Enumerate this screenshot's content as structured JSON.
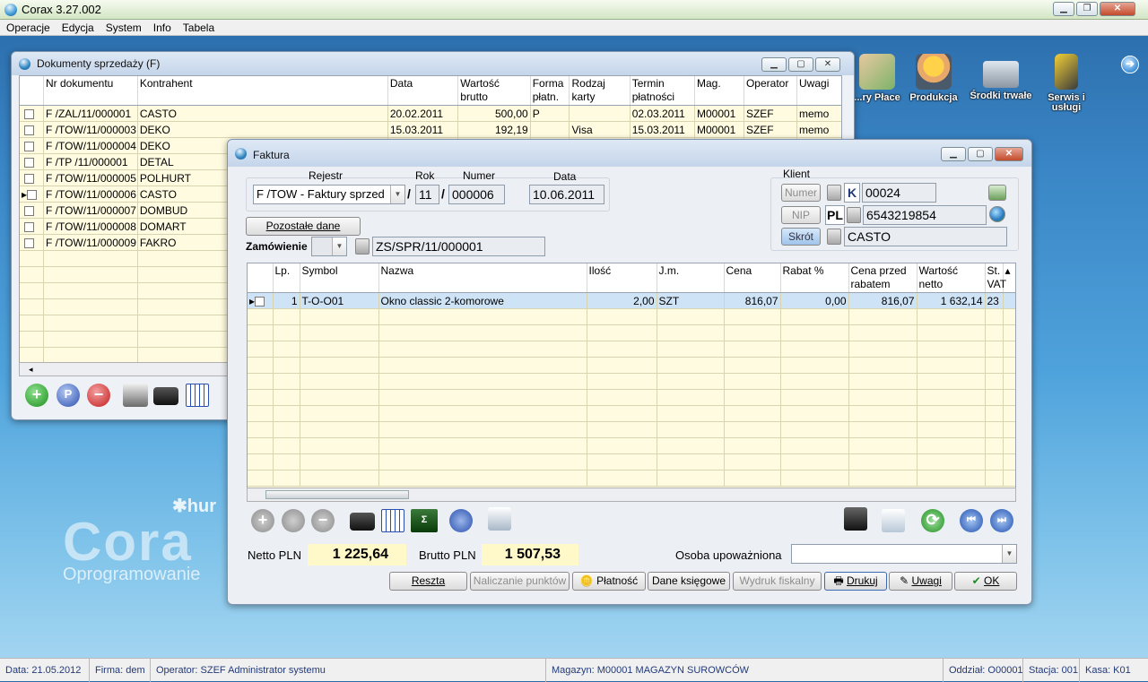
{
  "app": {
    "title": "Corax 3.27.002"
  },
  "menu": [
    "Operacje",
    "Edycja",
    "System",
    "Info",
    "Tabela"
  ],
  "desktop_icons": [
    {
      "label": "...ry Płace",
      "icon": "money-hand-icon"
    },
    {
      "label": "Produkcja",
      "icon": "worker-icon"
    },
    {
      "label": "Środki trwałe",
      "icon": "truck-icon"
    },
    {
      "label": "Serwis i usługi",
      "icon": "drill-icon"
    }
  ],
  "brand": {
    "small": "hur",
    "big": "Cora",
    "tag": "Oprogramowanie"
  },
  "list_window": {
    "title": "Dokumenty sprzedaży (F)",
    "columns": [
      "Nr dokumentu",
      "Kontrahent",
      "Data",
      "Wartość brutto",
      "Forma płatn.",
      "Rodzaj karty",
      "Termin płatności",
      "Mag.",
      "Operator",
      "Uwagi"
    ],
    "rows": [
      [
        "F /ZAL/11/000001",
        "CASTO",
        "20.02.2011",
        "500,00",
        "P",
        "",
        "02.03.2011",
        "M00001",
        "SZEF",
        "memo"
      ],
      [
        "F /TOW/11/000003",
        "DEKO",
        "15.03.2011",
        "192,19",
        "",
        "Visa",
        "15.03.2011",
        "M00001",
        "SZEF",
        "memo"
      ],
      [
        "F /TOW/11/000004",
        "DEKO",
        "",
        "",
        "",
        "",
        "",
        "",
        "",
        ""
      ],
      [
        "F /TP /11/000001",
        "DETAL",
        "",
        "",
        "",
        "",
        "",
        "",
        "",
        ""
      ],
      [
        "F /TOW/11/000005",
        "POLHURT",
        "",
        "",
        "",
        "",
        "",
        "",
        "",
        ""
      ],
      [
        "F /TOW/11/000006",
        "CASTO",
        "",
        "",
        "",
        "",
        "",
        "",
        "",
        ""
      ],
      [
        "F /TOW/11/000007",
        "DOMBUD",
        "",
        "",
        "",
        "",
        "",
        "",
        "",
        ""
      ],
      [
        "F /TOW/11/000008",
        "DOMART",
        "",
        "",
        "",
        "",
        "",
        "",
        "",
        ""
      ],
      [
        "F /TOW/11/000009",
        "FAKRO",
        "",
        "",
        "",
        "",
        "",
        "",
        "",
        ""
      ]
    ]
  },
  "invoice": {
    "title": "Faktura",
    "rejestr_label": "Rejestr",
    "rok_label": "Rok",
    "numer_label": "Numer",
    "data_label": "Data",
    "rejestr": "F /TOW - Faktury sprzed",
    "rok": "11",
    "numer": "000006",
    "data": "10.06.2011",
    "slash": "/",
    "pozostale": "Pozostałe dane",
    "zamowienie_label": "Zamówienie",
    "zamowienie": "ZS/SPR/11/000001",
    "klient_label": "Klient",
    "numer_btn": "Numer",
    "nip_btn": "NIP",
    "skrot_btn": "Skrót",
    "k_prefix": "K",
    "k_value": "00024",
    "pl_prefix": "PL",
    "nip_value": "6543219854",
    "skrot_value": "CASTO",
    "columns": [
      "Lp.",
      "Symbol",
      "Nazwa",
      "Ilość",
      "J.m.",
      "Cena",
      "Rabat %",
      "Cena przed rabatem",
      "Wartość netto",
      "St. VAT"
    ],
    "items": [
      {
        "lp": "1",
        "symbol": "T-O-O01",
        "nazwa": "Okno classic 2-komorowe",
        "ilosc": "2,00",
        "jm": "SZT",
        "cena": "816,07",
        "rabat": "0,00",
        "cena_przed": "816,07",
        "wartosc": "1 632,14",
        "vat": "23"
      }
    ],
    "netto_label": "Netto PLN",
    "netto": "1 225,64",
    "brutto_label": "Brutto PLN",
    "brutto": "1 507,53",
    "osoba_label": "Osoba upoważniona",
    "buttons": {
      "reszta": "Reszta",
      "punkty": "Naliczanie punktów",
      "platnosc": "Płatność",
      "ksiegowe": "Dane księgowe",
      "fiskalny": "Wydruk fiskalny",
      "drukuj": "Drukuj",
      "uwagi": "Uwagi",
      "ok": "OK"
    }
  },
  "status": {
    "data": "Data: 21.05.2012",
    "firma": "Firma: dem",
    "operator": "Operator: SZEF Administrator systemu",
    "magazyn": "Magazyn: M00001 MAGAZYN SUROWCÓW",
    "oddzial": "Oddział: O00001",
    "stacja": "Stacja: 001",
    "kasa": "Kasa: K01"
  },
  "colors": {
    "selected_row": "#cfe3f7",
    "grid_bg": "#fffbe0",
    "amount_bg": "#fff8c8"
  }
}
